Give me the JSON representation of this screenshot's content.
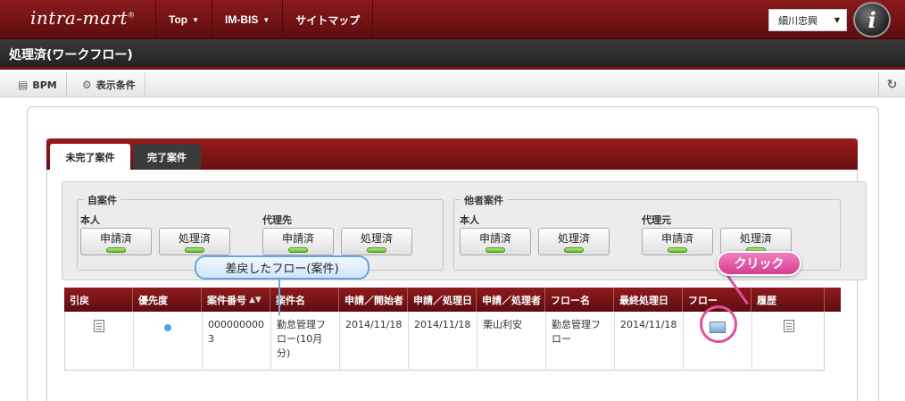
{
  "header": {
    "logo": "intra-mart",
    "logo_mark": "®",
    "nav": [
      {
        "label": "Top",
        "caret": "▼"
      },
      {
        "label": "IM-BIS",
        "caret": "▼"
      },
      {
        "label": "サイトマップ",
        "caret": ""
      }
    ],
    "user": "細川忠興",
    "user_caret": "▼",
    "avatar_letter": "i"
  },
  "page_title": "処理済(ワークフロー)",
  "toolbar": {
    "bpm_label": "BPM",
    "display_cond_label": "表示条件"
  },
  "tabs": [
    {
      "label": "未完了案件",
      "active": true
    },
    {
      "label": "完了案件",
      "active": false
    }
  ],
  "filter": {
    "own": {
      "legend": "自案件",
      "groups": [
        {
          "label": "本人",
          "buttons": [
            "申請済",
            "処理済"
          ]
        },
        {
          "label": "代理先",
          "buttons": [
            "申請済",
            "処理済"
          ]
        }
      ]
    },
    "others": {
      "legend": "他者案件",
      "groups": [
        {
          "label": "本人",
          "buttons": [
            "申請済",
            "処理済"
          ]
        },
        {
          "label": "代理元",
          "buttons": [
            "申請済",
            "処理済"
          ]
        }
      ]
    }
  },
  "table": {
    "columns": [
      "引戻",
      "優先度",
      "案件番号",
      "案件名",
      "申請／開始者",
      "申請／処理日",
      "申請／処理者",
      "フロー名",
      "最終処理日",
      "フロー",
      "履歴"
    ],
    "sort_indicator": "▲▼",
    "rows": [
      {
        "case_number": "0000000003",
        "case_name": "勤怠管理フロー(10月分)",
        "date1": "2014/11/18",
        "date2": "2014/11/18",
        "processor": "栗山利安",
        "flow_name": "勤怠管理フロー",
        "last_date": "2014/11/18"
      }
    ]
  },
  "annotations": {
    "callout": "差戻したフロー(案件)",
    "click_label": "クリック"
  },
  "colors": {
    "brand_red": "#7a1214",
    "accent_pink": "#e0509e",
    "callout_blue": "#6aa4e0"
  }
}
